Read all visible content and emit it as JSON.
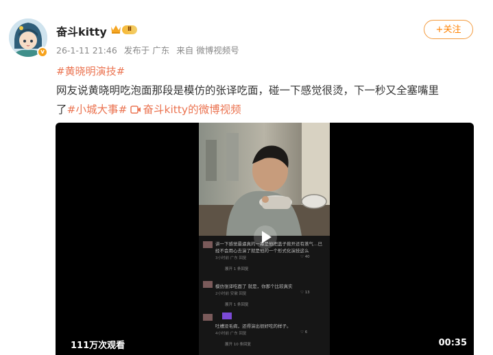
{
  "post": {
    "username": "奋斗kitty",
    "verified_glyph": "v",
    "level_badge": "Ⅱ",
    "date": "26-1-11 21:46",
    "published_from": "发布于 广东",
    "source": "来自 微博视频号",
    "follow_label": "+关注",
    "hashtag": "#黄晓明演技#",
    "text_line1": "网友说黄晓明吃泡面那段是模仿的张译吃面，碰一下感觉很烫，下一秒又全塞嘴里",
    "text_tail": "了",
    "tag2": "#小城大事#",
    "video_link": "奋斗kitty的微博视频"
  },
  "video": {
    "views": "111万次观看",
    "duration": "00:35",
    "comments": [
      {
        "line1": "讲一下感觉最逼真的一幕是他把盖子掀开还有蒸气…已",
        "line2": "经不会用心去演了就是他的一个形式化演技这么",
        "meta": "3小时前 广东   回复",
        "likes": "40",
        "replies": "展开 1 条回复"
      },
      {
        "line1": "模仿张译吃面了 就是，你那个比较真实",
        "meta": "2小时前 安徽   回复",
        "likes": "13",
        "replies": "展开 1 条回复"
      },
      {
        "line1": "吐槽没毛病，还得演出很好吃的样子。",
        "meta": "4小时前 广东   回复",
        "likes": "6",
        "replies": "展开 10 条回复"
      }
    ]
  },
  "colors": {
    "accent": "#ff8200",
    "link": "#eb7350",
    "meta": "#888888",
    "video_bg": "#000000"
  },
  "icons": [
    "verified-badge-icon",
    "crown-icon",
    "video-link-icon",
    "play-icon",
    "like-icon"
  ]
}
